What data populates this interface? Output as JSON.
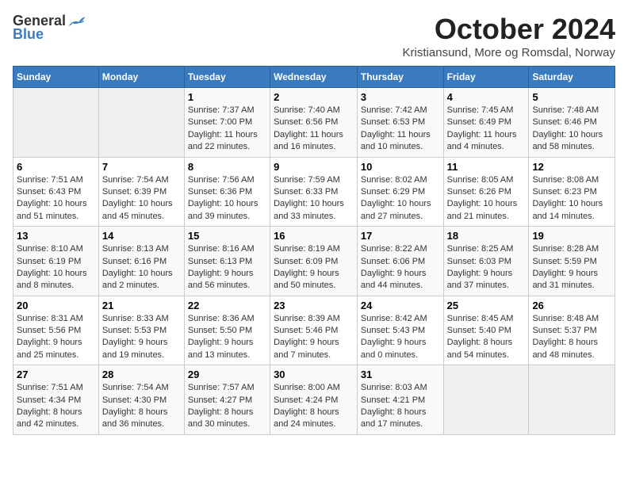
{
  "logo": {
    "general": "General",
    "blue": "Blue"
  },
  "title": "October 2024",
  "subtitle": "Kristiansund, More og Romsdal, Norway",
  "weekdays": [
    "Sunday",
    "Monday",
    "Tuesday",
    "Wednesday",
    "Thursday",
    "Friday",
    "Saturday"
  ],
  "weeks": [
    [
      {
        "day": "",
        "info": ""
      },
      {
        "day": "",
        "info": ""
      },
      {
        "day": "1",
        "info": "Sunrise: 7:37 AM\nSunset: 7:00 PM\nDaylight: 11 hours\nand 22 minutes."
      },
      {
        "day": "2",
        "info": "Sunrise: 7:40 AM\nSunset: 6:56 PM\nDaylight: 11 hours\nand 16 minutes."
      },
      {
        "day": "3",
        "info": "Sunrise: 7:42 AM\nSunset: 6:53 PM\nDaylight: 11 hours\nand 10 minutes."
      },
      {
        "day": "4",
        "info": "Sunrise: 7:45 AM\nSunset: 6:49 PM\nDaylight: 11 hours\nand 4 minutes."
      },
      {
        "day": "5",
        "info": "Sunrise: 7:48 AM\nSunset: 6:46 PM\nDaylight: 10 hours\nand 58 minutes."
      }
    ],
    [
      {
        "day": "6",
        "info": "Sunrise: 7:51 AM\nSunset: 6:43 PM\nDaylight: 10 hours\nand 51 minutes."
      },
      {
        "day": "7",
        "info": "Sunrise: 7:54 AM\nSunset: 6:39 PM\nDaylight: 10 hours\nand 45 minutes."
      },
      {
        "day": "8",
        "info": "Sunrise: 7:56 AM\nSunset: 6:36 PM\nDaylight: 10 hours\nand 39 minutes."
      },
      {
        "day": "9",
        "info": "Sunrise: 7:59 AM\nSunset: 6:33 PM\nDaylight: 10 hours\nand 33 minutes."
      },
      {
        "day": "10",
        "info": "Sunrise: 8:02 AM\nSunset: 6:29 PM\nDaylight: 10 hours\nand 27 minutes."
      },
      {
        "day": "11",
        "info": "Sunrise: 8:05 AM\nSunset: 6:26 PM\nDaylight: 10 hours\nand 21 minutes."
      },
      {
        "day": "12",
        "info": "Sunrise: 8:08 AM\nSunset: 6:23 PM\nDaylight: 10 hours\nand 14 minutes."
      }
    ],
    [
      {
        "day": "13",
        "info": "Sunrise: 8:10 AM\nSunset: 6:19 PM\nDaylight: 10 hours\nand 8 minutes."
      },
      {
        "day": "14",
        "info": "Sunrise: 8:13 AM\nSunset: 6:16 PM\nDaylight: 10 hours\nand 2 minutes."
      },
      {
        "day": "15",
        "info": "Sunrise: 8:16 AM\nSunset: 6:13 PM\nDaylight: 9 hours\nand 56 minutes."
      },
      {
        "day": "16",
        "info": "Sunrise: 8:19 AM\nSunset: 6:09 PM\nDaylight: 9 hours\nand 50 minutes."
      },
      {
        "day": "17",
        "info": "Sunrise: 8:22 AM\nSunset: 6:06 PM\nDaylight: 9 hours\nand 44 minutes."
      },
      {
        "day": "18",
        "info": "Sunrise: 8:25 AM\nSunset: 6:03 PM\nDaylight: 9 hours\nand 37 minutes."
      },
      {
        "day": "19",
        "info": "Sunrise: 8:28 AM\nSunset: 5:59 PM\nDaylight: 9 hours\nand 31 minutes."
      }
    ],
    [
      {
        "day": "20",
        "info": "Sunrise: 8:31 AM\nSunset: 5:56 PM\nDaylight: 9 hours\nand 25 minutes."
      },
      {
        "day": "21",
        "info": "Sunrise: 8:33 AM\nSunset: 5:53 PM\nDaylight: 9 hours\nand 19 minutes."
      },
      {
        "day": "22",
        "info": "Sunrise: 8:36 AM\nSunset: 5:50 PM\nDaylight: 9 hours\nand 13 minutes."
      },
      {
        "day": "23",
        "info": "Sunrise: 8:39 AM\nSunset: 5:46 PM\nDaylight: 9 hours\nand 7 minutes."
      },
      {
        "day": "24",
        "info": "Sunrise: 8:42 AM\nSunset: 5:43 PM\nDaylight: 9 hours\nand 0 minutes."
      },
      {
        "day": "25",
        "info": "Sunrise: 8:45 AM\nSunset: 5:40 PM\nDaylight: 8 hours\nand 54 minutes."
      },
      {
        "day": "26",
        "info": "Sunrise: 8:48 AM\nSunset: 5:37 PM\nDaylight: 8 hours\nand 48 minutes."
      }
    ],
    [
      {
        "day": "27",
        "info": "Sunrise: 7:51 AM\nSunset: 4:34 PM\nDaylight: 8 hours\nand 42 minutes."
      },
      {
        "day": "28",
        "info": "Sunrise: 7:54 AM\nSunset: 4:30 PM\nDaylight: 8 hours\nand 36 minutes."
      },
      {
        "day": "29",
        "info": "Sunrise: 7:57 AM\nSunset: 4:27 PM\nDaylight: 8 hours\nand 30 minutes."
      },
      {
        "day": "30",
        "info": "Sunrise: 8:00 AM\nSunset: 4:24 PM\nDaylight: 8 hours\nand 24 minutes."
      },
      {
        "day": "31",
        "info": "Sunrise: 8:03 AM\nSunset: 4:21 PM\nDaylight: 8 hours\nand 17 minutes."
      },
      {
        "day": "",
        "info": ""
      },
      {
        "day": "",
        "info": ""
      }
    ]
  ]
}
